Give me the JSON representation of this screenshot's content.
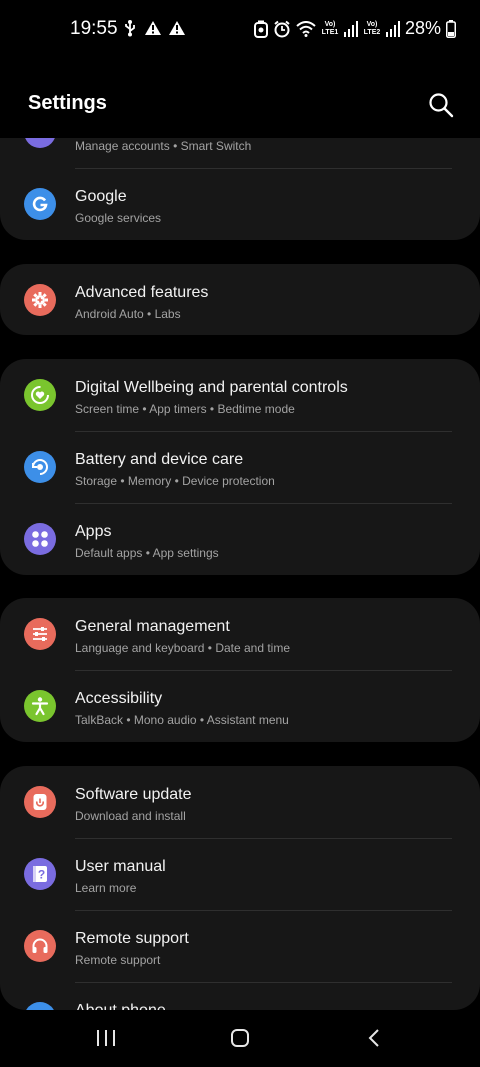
{
  "status_bar": {
    "time": "19:55",
    "battery_percent": "28%",
    "lte1": "Vo) LTE1",
    "lte2": "Vo) LTE2",
    "left_icons": [
      "usb-icon",
      "warning-icon",
      "warning-icon"
    ],
    "right_icons": [
      "battery-saver-icon",
      "alarm-icon",
      "wifi-icon",
      "signal-icon",
      "signal-icon",
      "battery-icon"
    ]
  },
  "header": {
    "title": "Settings"
  },
  "groups": [
    {
      "items": [
        {
          "title": "",
          "subtitle": "Manage accounts • Smart Switch",
          "icon": "accounts-icon",
          "color": "#7a6ce0"
        },
        {
          "title": "Google",
          "subtitle": "Google services",
          "icon": "google-icon",
          "color": "#3d8fe8"
        }
      ]
    },
    {
      "items": [
        {
          "title": "Advanced features",
          "subtitle": "Android Auto • Labs",
          "icon": "gear-plus-icon",
          "color": "#e86b5c"
        }
      ]
    },
    {
      "items": [
        {
          "title": "Digital Wellbeing and parental controls",
          "subtitle": "Screen time • App timers • Bedtime mode",
          "icon": "wellbeing-icon",
          "color": "#7ac52e"
        },
        {
          "title": "Battery and device care",
          "subtitle": "Storage • Memory • Device protection",
          "icon": "device-care-icon",
          "color": "#3d8fe8"
        },
        {
          "title": "Apps",
          "subtitle": "Default apps • App settings",
          "icon": "apps-icon",
          "color": "#7a6ce0"
        }
      ]
    },
    {
      "items": [
        {
          "title": "General management",
          "subtitle": "Language and keyboard • Date and time",
          "icon": "sliders-icon",
          "color": "#e86b5c"
        },
        {
          "title": "Accessibility",
          "subtitle": "TalkBack • Mono audio • Assistant menu",
          "icon": "accessibility-icon",
          "color": "#7ac52e"
        }
      ]
    },
    {
      "items": [
        {
          "title": "Software update",
          "subtitle": "Download and install",
          "icon": "software-update-icon",
          "color": "#e86b5c"
        },
        {
          "title": "User manual",
          "subtitle": "Learn more",
          "icon": "user-manual-icon",
          "color": "#7a6ce0"
        },
        {
          "title": "Remote support",
          "subtitle": "Remote support",
          "icon": "headset-icon",
          "color": "#e86b5c"
        },
        {
          "title": "About phone",
          "subtitle": "",
          "icon": "info-icon",
          "color": "#3d8fe8"
        }
      ]
    }
  ],
  "nav_bar": {
    "buttons": [
      "recents-icon",
      "home-icon",
      "back-icon"
    ]
  }
}
